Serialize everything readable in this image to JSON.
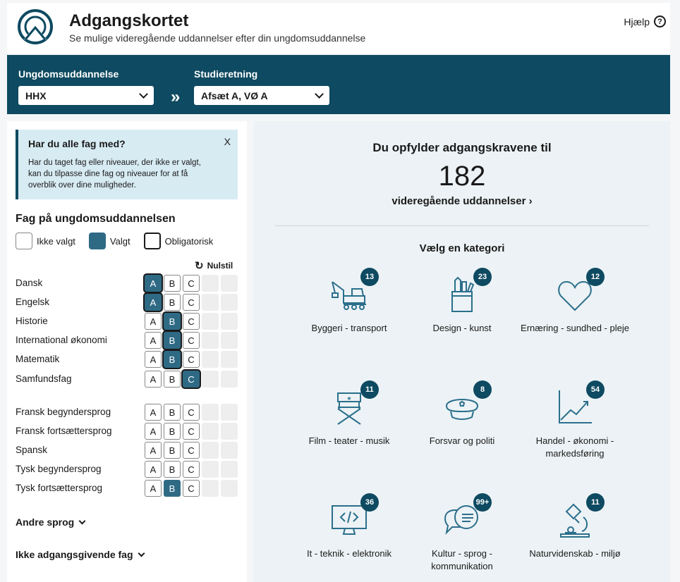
{
  "header": {
    "title": "Adgangskortet",
    "subtitle": "Se mulige videregående uddannelser efter din ungdomsuddannelse",
    "help_label": "Hjælp",
    "help_icon_glyph": "?"
  },
  "selectors": {
    "education_label": "Ungdomsuddannelse",
    "education_value": "HHX",
    "separator": "»",
    "direction_label": "Studieretning",
    "direction_value": "Afsæt A, VØ A"
  },
  "notice": {
    "title": "Har du alle fag med?",
    "body": "Har du taget fag eller niveauer, der ikke er valgt, kan du tilpasse dine fag og niveauer for at få overblik over dine muligheder.",
    "close": "X"
  },
  "subjects_panel": {
    "title": "Fag på ungdomsuddannelsen",
    "legend": {
      "not_chosen": "Ikke valgt",
      "chosen": "Valgt",
      "mandatory": "Obligatorisk"
    },
    "reset_label": "Nulstil",
    "reset_icon": "↻",
    "subjects": [
      {
        "name": "Dansk",
        "levels": [
          "A",
          "B",
          "C"
        ],
        "chosen": "A",
        "mandatory": true
      },
      {
        "name": "Engelsk",
        "levels": [
          "A",
          "B",
          "C"
        ],
        "chosen": "A",
        "mandatory": true
      },
      {
        "name": "Historie",
        "levels": [
          "A",
          "B",
          "C"
        ],
        "chosen": "B",
        "mandatory": true
      },
      {
        "name": "International økonomi",
        "levels": [
          "A",
          "B",
          "C"
        ],
        "chosen": "B",
        "mandatory": true
      },
      {
        "name": "Matematik",
        "levels": [
          "A",
          "B",
          "C"
        ],
        "chosen": "B",
        "mandatory": true
      },
      {
        "name": "Samfundsfag",
        "levels": [
          "A",
          "B",
          "C"
        ],
        "chosen": "C",
        "mandatory": true
      },
      {
        "name": "Fransk begyndersprog",
        "levels": [
          "A",
          "B",
          "C"
        ],
        "chosen": "",
        "mandatory": false
      },
      {
        "name": "Fransk fortsættersprog",
        "levels": [
          "A",
          "B",
          "C"
        ],
        "chosen": "",
        "mandatory": false
      },
      {
        "name": "Spansk",
        "levels": [
          "A",
          "B",
          "C"
        ],
        "chosen": "",
        "mandatory": false
      },
      {
        "name": "Tysk begyndersprog",
        "levels": [
          "A",
          "B",
          "C"
        ],
        "chosen": "",
        "mandatory": false
      },
      {
        "name": "Tysk fortsættersprog",
        "levels": [
          "A",
          "B",
          "C"
        ],
        "chosen": "B",
        "mandatory": false
      }
    ],
    "other_languages_label": "Andre sprog",
    "non_qualifying_label": "Ikke adgangsgivende fag"
  },
  "results": {
    "heading": "Du opfylder adgangskravene til",
    "count": "182",
    "link_label": "videregående uddannelser ›",
    "category_heading": "Vælg en kategori",
    "categories": [
      {
        "label": "Byggeri - transport",
        "count": "13",
        "icon": "crane-truck-icon"
      },
      {
        "label": "Design - kunst",
        "count": "23",
        "icon": "pencil-cup-icon"
      },
      {
        "label": "Ernæring - sundhed - pleje",
        "count": "12",
        "icon": "heart-icon"
      },
      {
        "label": "Film - teater - musik",
        "count": "11",
        "icon": "director-chair-icon"
      },
      {
        "label": "Forsvar og politi",
        "count": "8",
        "icon": "police-cap-icon"
      },
      {
        "label": "Handel - økonomi - markedsføring",
        "count": "54",
        "icon": "trend-chart-icon"
      },
      {
        "label": "It - teknik - elektronik",
        "count": "36",
        "icon": "code-monitor-icon"
      },
      {
        "label": "Kultur - sprog - kommunikation",
        "count": "99+",
        "icon": "speech-bubbles-icon"
      },
      {
        "label": "Naturvidenskab - miljø",
        "count": "11",
        "icon": "microscope-icon"
      }
    ]
  },
  "colors": {
    "brand": "#0e4a61",
    "chosen": "#2f6a85",
    "icon_stroke": "#2b6f8c"
  }
}
